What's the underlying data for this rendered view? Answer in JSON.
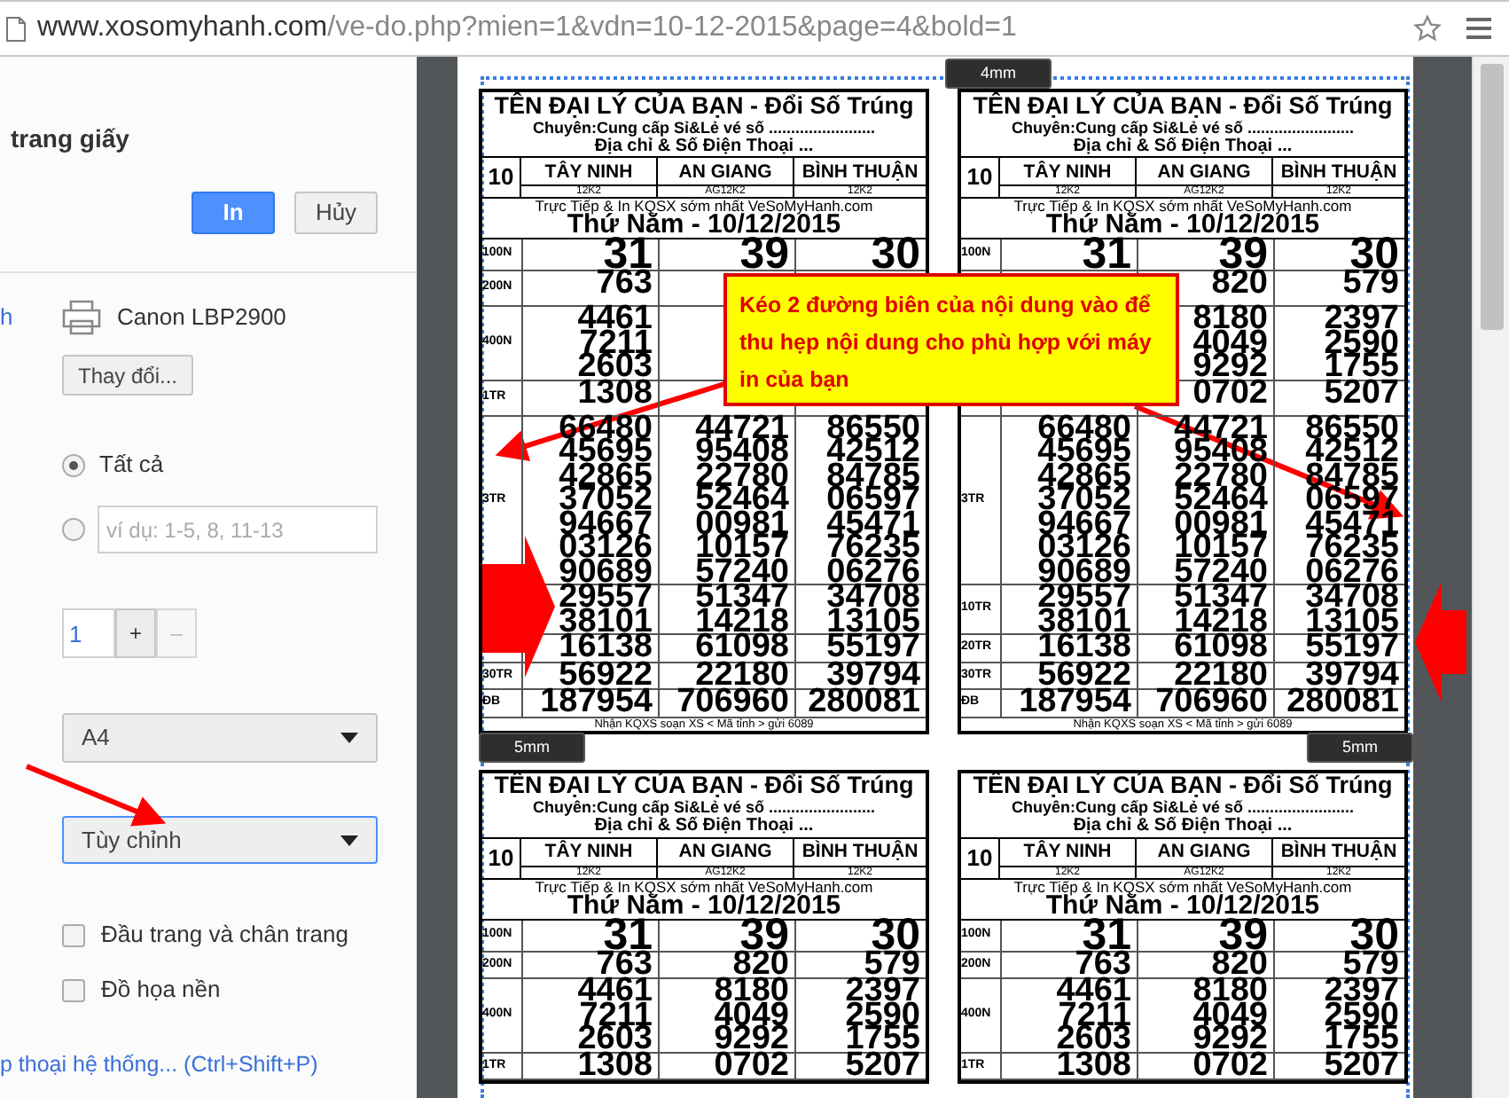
{
  "address_bar": {
    "host": "www.xosomyhanh.com",
    "path": "/ve-do.php?mien=1&vdn=10-12-2015&page=4&bold=1"
  },
  "print_panel": {
    "heading": "trang giấy",
    "buttons": [
      {
        "label": "In",
        "kind": "primary"
      },
      {
        "label": "Hủy",
        "kind": "secondary"
      }
    ],
    "destination_fragment": "h",
    "printer": "Canon LBP2900",
    "change_button": "Thay đổi...",
    "pages": [
      {
        "kind": "all",
        "label": "Tất cả",
        "selected": true
      },
      {
        "kind": "range",
        "placeholder": "ví dụ: 1-5, 8, 11-13",
        "selected": false
      }
    ],
    "copies": {
      "value": "1",
      "plus": "+",
      "minus": "–",
      "minus_disabled": true
    },
    "selects": [
      {
        "value": "A4",
        "focused": false
      },
      {
        "value": "Tùy chỉnh",
        "focused": true
      }
    ],
    "options": [
      {
        "label": "Đầu trang và chân trang",
        "checked": false
      },
      {
        "label": "Đồ họa nền",
        "checked": false
      }
    ],
    "system_dialog_link": "p thoại hệ thống... (Ctrl+Shift+P)"
  },
  "preview": {
    "tickets": [
      {
        "title": "TÊN ĐẠI LÝ CỦA BẠN - Đổi Số Trúng",
        "subtitle": "Chuyên:Cung cấp Sỉ&Lẻ vé số ........................",
        "address": "Địa chỉ & Số Điện Thoại ...",
        "day": "10",
        "provinces": [
          {
            "name": "TÂY NINH",
            "code": "12K2"
          },
          {
            "name": "AN GIANG",
            "code": "AG12K2"
          },
          {
            "name": "BÌNH THUẬN",
            "code": "12K2"
          }
        ],
        "promo": "Trực Tiếp & In KQSX sớm nhất VeSoMyHanh.com",
        "date": "Thứ Năm - 10/12/2015",
        "prizes": [
          {
            "label": "100N",
            "cells": [
              [
                "31"
              ],
              [
                "39"
              ],
              [
                "30"
              ]
            ]
          },
          {
            "label": "200N",
            "cells": [
              [
                "763"
              ],
              null,
              null
            ]
          },
          {
            "label": "400N",
            "cells": [
              [
                "4461",
                "7211",
                "2603"
              ],
              null,
              null
            ]
          },
          {
            "label": "1TR",
            "cells": [
              [
                "1308"
              ],
              null,
              null
            ]
          },
          {
            "label": "3TR",
            "cells": [
              [
                "66480",
                "45695",
                "42865",
                "37052",
                "94667",
                "03126",
                "90689"
              ],
              [
                "44721",
                "95408",
                "22780",
                "52464",
                "00981",
                "10157",
                "57240"
              ],
              [
                "86550",
                "42512",
                "84785",
                "06597",
                "45471",
                "76235",
                "06276"
              ]
            ]
          },
          {
            "cells": [
              [
                "29557",
                "38101"
              ],
              [
                "51347",
                "14218"
              ],
              [
                "34708",
                "13105"
              ]
            ]
          },
          {
            "cells": [
              [
                "16138"
              ],
              [
                "61098"
              ],
              [
                "55197"
              ]
            ]
          },
          {
            "label": "30TR",
            "cells": [
              [
                "56922"
              ],
              [
                "22180"
              ],
              [
                "39794"
              ]
            ]
          },
          {
            "label": "ĐB",
            "cells": [
              [
                "187954"
              ],
              [
                "706960"
              ],
              [
                "280081"
              ]
            ]
          }
        ],
        "footer": "Nhận KQXS soạn XS < Mã tỉnh > gửi 6089"
      },
      {
        "title": "TÊN ĐẠI LÝ CỦA BẠN - Đổi Số Trúng",
        "subtitle": "Chuyên:Cung cấp Sỉ&Lẻ vé số ........................",
        "address": "Địa chỉ & Số Điện Thoại ...",
        "day": "10",
        "provinces": [
          {
            "name": "TÂY NINH",
            "code": "12K2"
          },
          {
            "name": "AN GIANG",
            "code": "AG12K2"
          },
          {
            "name": "BÌNH THUẬN",
            "code": "12K2"
          }
        ],
        "promo": "Trực Tiếp & In KQSX sớm nhất VeSoMyHanh.com",
        "date": "Thứ Năm - 10/12/2015",
        "prizes": [
          {
            "label": "100N",
            "cells": [
              [
                "31"
              ],
              [
                "39"
              ],
              [
                "30"
              ]
            ]
          },
          {
            "cells": [
              null,
              [
                "820"
              ],
              [
                "579"
              ]
            ]
          },
          {
            "cells": [
              null,
              [
                "8180",
                "4049",
                "9292"
              ],
              [
                "2397",
                "2590",
                "1755"
              ]
            ]
          },
          {
            "cells": [
              null,
              [
                "0702"
              ],
              [
                "5207"
              ]
            ]
          },
          {
            "label": "3TR",
            "cells": [
              [
                "66480",
                "45695",
                "42865",
                "37052",
                "94667",
                "03126",
                "90689"
              ],
              [
                "44721",
                "95408",
                "22780",
                "52464",
                "00981",
                "10157",
                "57240"
              ],
              [
                "86550",
                "42512",
                "84785",
                "06597",
                "45471",
                "76235",
                "06276"
              ]
            ]
          },
          {
            "label": "10TR",
            "cells": [
              [
                "29557",
                "38101"
              ],
              [
                "51347",
                "14218"
              ],
              [
                "34708",
                "13105"
              ]
            ]
          },
          {
            "label": "20TR",
            "cells": [
              [
                "16138"
              ],
              [
                "61098"
              ],
              [
                "55197"
              ]
            ]
          },
          {
            "label": "30TR",
            "cells": [
              [
                "56922"
              ],
              [
                "22180"
              ],
              [
                "39794"
              ]
            ]
          },
          {
            "label": "ĐB",
            "cells": [
              [
                "187954"
              ],
              [
                "706960"
              ],
              [
                "280081"
              ]
            ]
          }
        ],
        "footer": "Nhận KQXS soạn XS < Mã tỉnh > gửi 6089"
      },
      {
        "title": "TÊN ĐẠI LÝ CỦA BẠN - Đổi Số Trúng",
        "subtitle": "Chuyên:Cung cấp Sỉ&Lẻ vé số ........................",
        "address": "Địa chỉ & Số Điện Thoại ...",
        "day": "10",
        "provinces": [
          {
            "name": "TÂY NINH",
            "code": "12K2"
          },
          {
            "name": "AN GIANG",
            "code": "AG12K2"
          },
          {
            "name": "BÌNH THUẬN",
            "code": "12K2"
          }
        ],
        "promo": "Trực Tiếp & In KQSX sớm nhất VeSoMyHanh.com",
        "date": "Thứ Năm - 10/12/2015",
        "prizes": [
          {
            "label": "100N",
            "cells": [
              [
                "31"
              ],
              [
                "39"
              ],
              [
                "30"
              ]
            ]
          },
          {
            "label": "200N",
            "cells": [
              [
                "763"
              ],
              [
                "820"
              ],
              [
                "579"
              ]
            ]
          },
          {
            "label": "400N",
            "cells": [
              [
                "4461",
                "7211",
                "2603"
              ],
              [
                "8180",
                "4049",
                "9292"
              ],
              [
                "2397",
                "2590",
                "1755"
              ]
            ]
          },
          {
            "label": "1TR",
            "cells": [
              [
                "1308"
              ],
              [
                "0702"
              ],
              [
                "5207"
              ]
            ]
          }
        ]
      },
      {
        "title": "TÊN ĐẠI LÝ CỦA BẠN - Đổi Số Trúng",
        "subtitle": "Chuyên:Cung cấp Sỉ&Lẻ vé số ........................",
        "address": "Địa chỉ & Số Điện Thoại ...",
        "day": "10",
        "provinces": [
          {
            "name": "TÂY NINH",
            "code": "12K2"
          },
          {
            "name": "AN GIANG",
            "code": "AG12K2"
          },
          {
            "name": "BÌNH THUẬN",
            "code": "12K2"
          }
        ],
        "promo": "Trực Tiếp & In KQSX sớm nhất VeSoMyHanh.com",
        "date": "Thứ Năm - 10/12/2015",
        "prizes": [
          {
            "label": "100N",
            "cells": [
              [
                "31"
              ],
              [
                "39"
              ],
              [
                "30"
              ]
            ]
          },
          {
            "label": "200N",
            "cells": [
              [
                "763"
              ],
              [
                "820"
              ],
              [
                "579"
              ]
            ]
          },
          {
            "label": "400N",
            "cells": [
              [
                "4461",
                "7211",
                "2603"
              ],
              [
                "8180",
                "4049",
                "9292"
              ],
              [
                "2397",
                "2590",
                "1755"
              ]
            ]
          },
          {
            "label": "1TR",
            "cells": [
              [
                "1308"
              ],
              [
                "0702"
              ],
              [
                "5207"
              ]
            ]
          }
        ]
      }
    ],
    "callout": "Kéo 2 đường biên của nội dung vào để thu hẹp nội dung cho phù hợp với máy in của bạn",
    "margin_tags": [
      "4mm",
      "5mm",
      "5mm"
    ]
  }
}
